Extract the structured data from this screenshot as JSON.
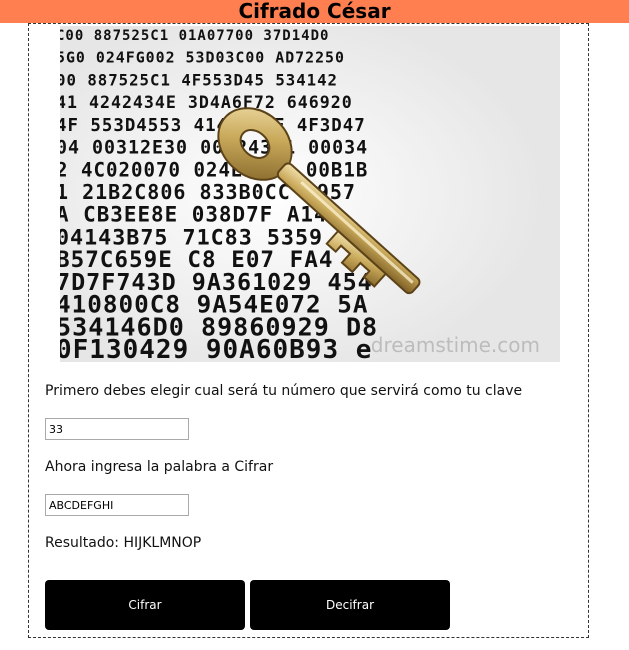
{
  "header": {
    "title": "Cifrado César"
  },
  "hero": {
    "rows": [
      "C00 887525C1 01A07700 37D14D0",
      "5G0 024FG002 53D03C00 AD72250",
      "00 887525C1 4F553D45 534142",
      "41 4242434E 3D4A6F72 646920",
      "4F 553D4553 4142422F 4F3D47",
      "04 00312E30 00424301 00034",
      "2 4C020070 024E4F4B 00B1B",
      "1 21B2C806 833B0CC 2957",
      "A CB3EE8E 038D7F A142",
      "04143B75 71C83 5359",
      "B57C659E C8 E07 FA4",
      "7D7F743D 9A361029 454",
      "410800C8 9A54E072 5A",
      "534146D0 89860929 D8",
      "0F130429 90A60B93 e"
    ],
    "watermark": "dreamstime.com"
  },
  "key_section": {
    "label": "Primero debes elegir cual será tu número que servirá como tu clave",
    "value": "33"
  },
  "word_section": {
    "label": "Ahora ingresa la palabra a Cifrar",
    "value": "ABCDEFGHI"
  },
  "result": {
    "text": "Resultado: HIJKLMNOP"
  },
  "buttons": {
    "encrypt": "Cifrar",
    "decrypt": "Decifrar"
  },
  "colors": {
    "header_bg": "#ff7f50",
    "button_bg": "#000000",
    "button_text": "#ffffff"
  },
  "icons": {
    "hero": "key-on-hex-code-image"
  }
}
